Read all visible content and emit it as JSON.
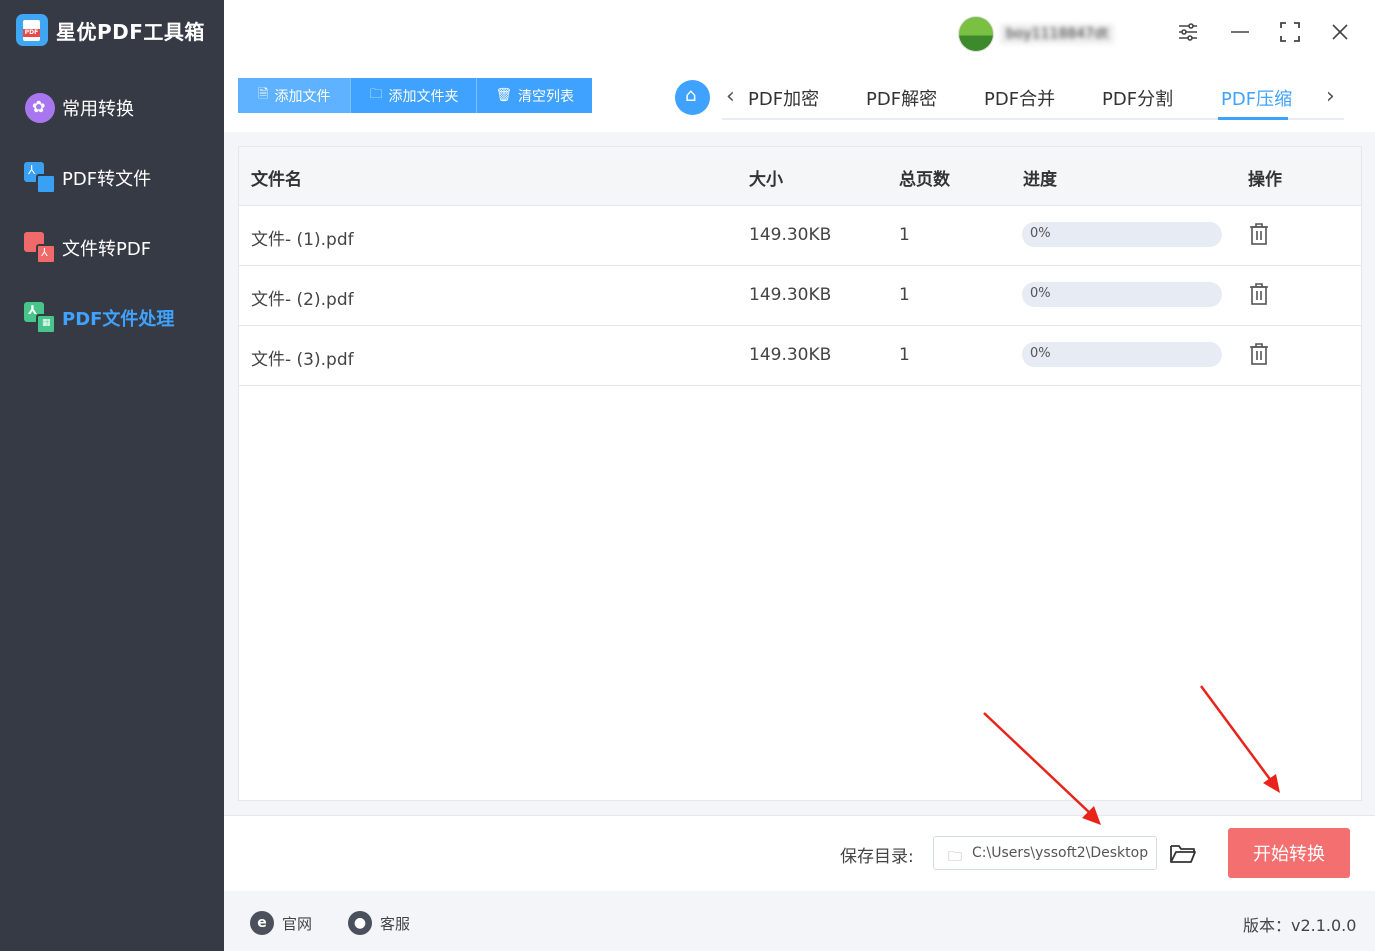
{
  "app": {
    "title": "星优PDF工具箱",
    "version_label": "版本：v2.1.0.0"
  },
  "user": {
    "name": "boy1118847dt"
  },
  "sidebar": {
    "items": [
      {
        "label": "常用转换",
        "icon": "flower-icon"
      },
      {
        "label": "PDF转文件",
        "icon": "pdf-to-file-icon"
      },
      {
        "label": "文件转PDF",
        "icon": "file-to-pdf-icon"
      },
      {
        "label": "PDF文件处理",
        "icon": "pdf-process-icon",
        "active": true
      }
    ]
  },
  "toolbar": {
    "add_file": "添加文件",
    "add_folder": "添加文件夹",
    "clear_list": "清空列表"
  },
  "tabs": [
    {
      "label": "PDF加密"
    },
    {
      "label": "PDF解密"
    },
    {
      "label": "PDF合并"
    },
    {
      "label": "PDF分割"
    },
    {
      "label": "PDF压缩",
      "active": true
    }
  ],
  "table": {
    "headers": [
      "文件名",
      "大小",
      "总页数",
      "进度",
      "操作"
    ],
    "rows": [
      {
        "name": "文件- (1).pdf",
        "size": "149.30KB",
        "pages": "1",
        "progress": "0%",
        "progress_value": 0
      },
      {
        "name": "文件- (2).pdf",
        "size": "149.30KB",
        "pages": "1",
        "progress": "0%",
        "progress_value": 0
      },
      {
        "name": "文件- (3).pdf",
        "size": "149.30KB",
        "pages": "1",
        "progress": "0%",
        "progress_value": 0
      }
    ]
  },
  "bottom": {
    "save_label": "保存目录:",
    "save_path": "C:\\Users\\yssoft2\\Desktop",
    "start_button": "开始转换"
  },
  "footer": {
    "website": "官网",
    "support": "客服"
  },
  "colors": {
    "accent": "#3fa2ff",
    "start": "#f46f6f",
    "sidebar": "#353a45",
    "annotation": "#e8231a"
  }
}
